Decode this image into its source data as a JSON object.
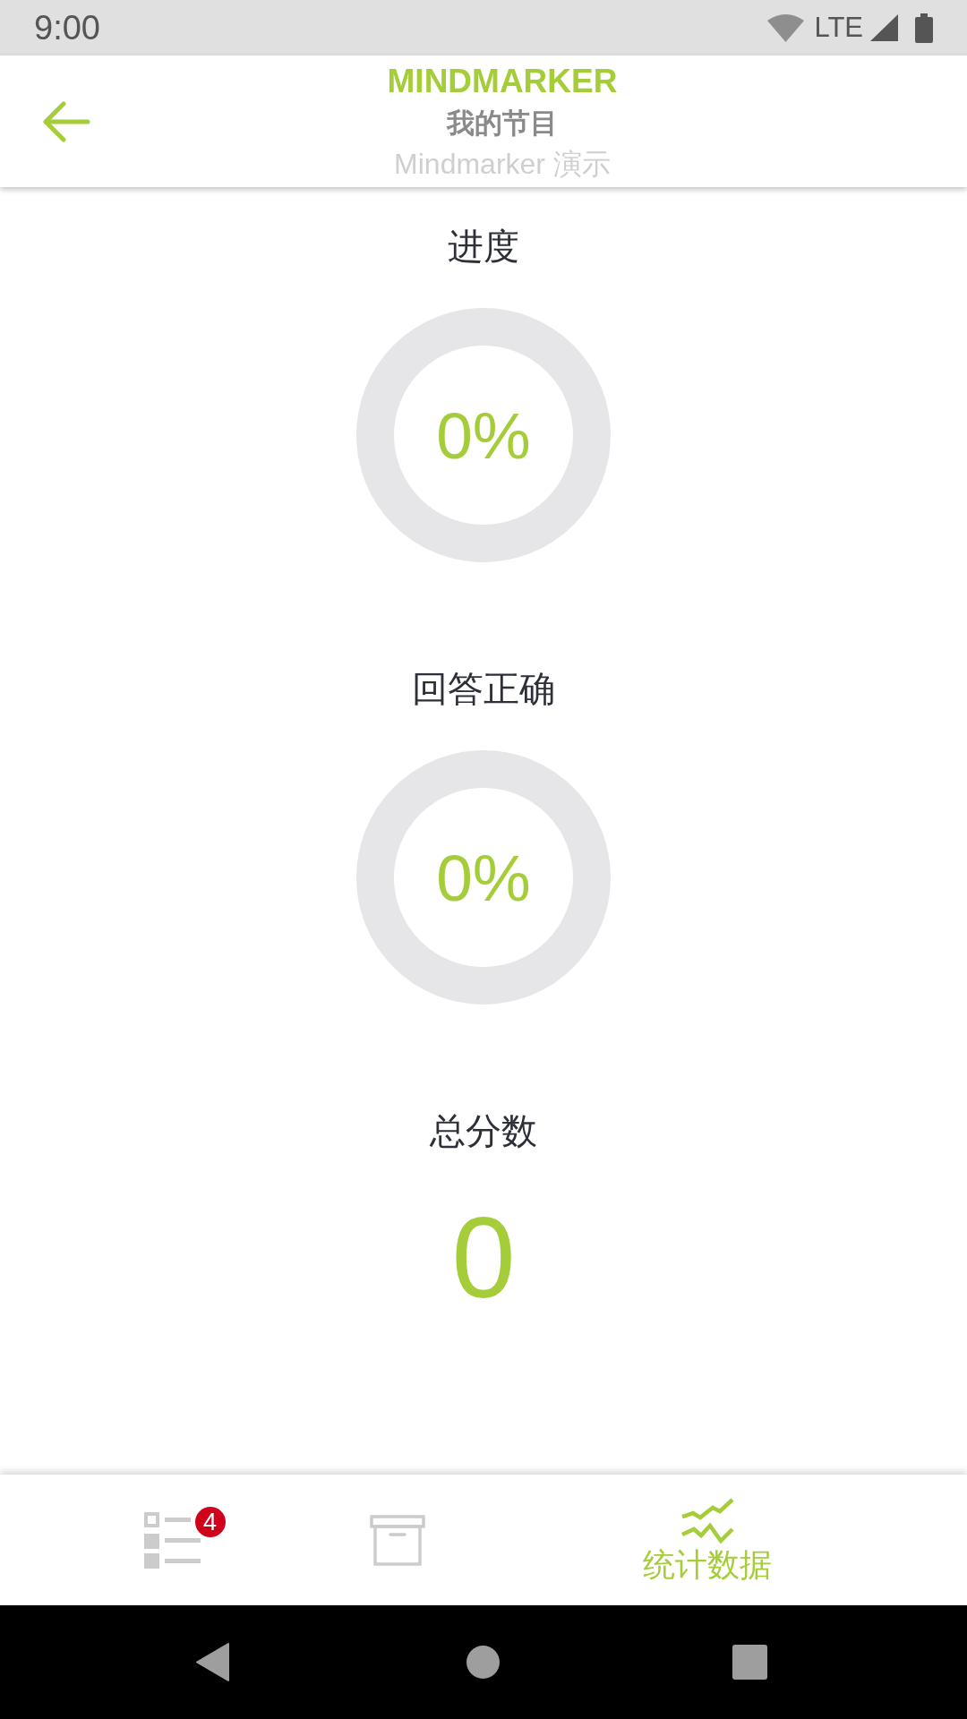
{
  "status_bar": {
    "time": "9:00",
    "network": "LTE"
  },
  "header": {
    "brand": "MINDMARKER",
    "title": "我的节目",
    "subtitle": "Mindmarker 演示"
  },
  "stats": [
    {
      "kind": "ring",
      "label": "进度",
      "value": "0%"
    },
    {
      "kind": "ring",
      "label": "回答正确",
      "value": "0%"
    },
    {
      "kind": "number",
      "label": "总分数",
      "value": "0"
    }
  ],
  "tabs": [
    {
      "kind": "list",
      "badge": "4",
      "selected": false
    },
    {
      "kind": "archive",
      "selected": false
    },
    {
      "kind": "chart",
      "label": "统计数据",
      "selected": true
    }
  ]
}
